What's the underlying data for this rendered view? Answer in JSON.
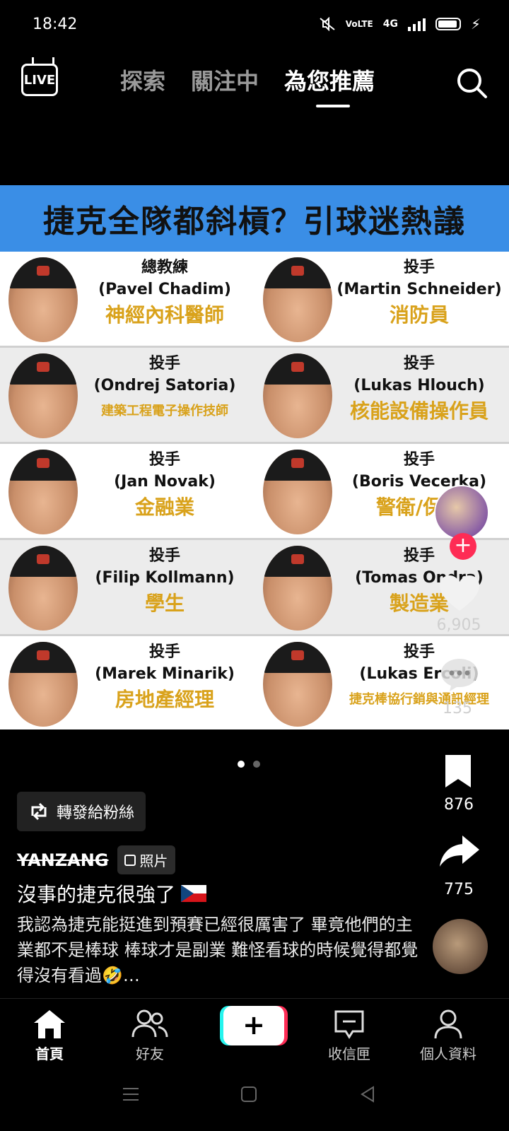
{
  "status_bar": {
    "time": "18:42",
    "network": "4G",
    "volte_label": "VoLTE"
  },
  "top_nav": {
    "live_label": "LIVE",
    "tabs": [
      {
        "label": "探索"
      },
      {
        "label": "關注中"
      },
      {
        "label": "為您推薦"
      }
    ]
  },
  "post_image": {
    "headline": "捷克全隊都斜槓？引球迷熱議",
    "players": [
      {
        "role": "總教練",
        "name": "(Pavel Chadim)",
        "job": "神經內科醫師"
      },
      {
        "role": "投手",
        "name": "(Martin Schneider)",
        "job": "消防員"
      },
      {
        "role": "投手",
        "name": "(Ondrej Satoria)",
        "job": "建築工程電子操作技師"
      },
      {
        "role": "投手",
        "name": "(Lukas Hlouch)",
        "job": "核能設備操作員"
      },
      {
        "role": "投手",
        "name": "(Jan Novak)",
        "job": "金融業"
      },
      {
        "role": "投手",
        "name": "(Boris Vecerka)",
        "job": "警衛/保全"
      },
      {
        "role": "投手",
        "name": "(Filip Kollmann)",
        "job": "學生"
      },
      {
        "role": "投手",
        "name": "(Tomas Ondra)",
        "job": "製造業"
      },
      {
        "role": "投手",
        "name": "(Marek Minarik)",
        "job": "房地產經理"
      },
      {
        "role": "投手",
        "name": "(Lukas Ercoli)",
        "job": "捷克棒協行銷與通訊經理"
      }
    ]
  },
  "actions": {
    "likes": "6,905",
    "comments": "135",
    "bookmarks": "876",
    "shares": "775"
  },
  "pager": {
    "total": 2,
    "current": 1
  },
  "repost_label": "轉發給粉絲",
  "caption": {
    "author": "YANZANG",
    "tag": "照片",
    "title": "沒事的捷克很強了",
    "body": "我認為捷克能挺進到預賽已經很厲害了 畢竟他們的主業都不是棒球 棒球才是副業 難怪看球的時候覺得都覺得沒有看過🤣…"
  },
  "bottom_nav": {
    "home": "首頁",
    "friends": "好友",
    "create": "+",
    "inbox": "收信匣",
    "profile": "個人資料"
  }
}
